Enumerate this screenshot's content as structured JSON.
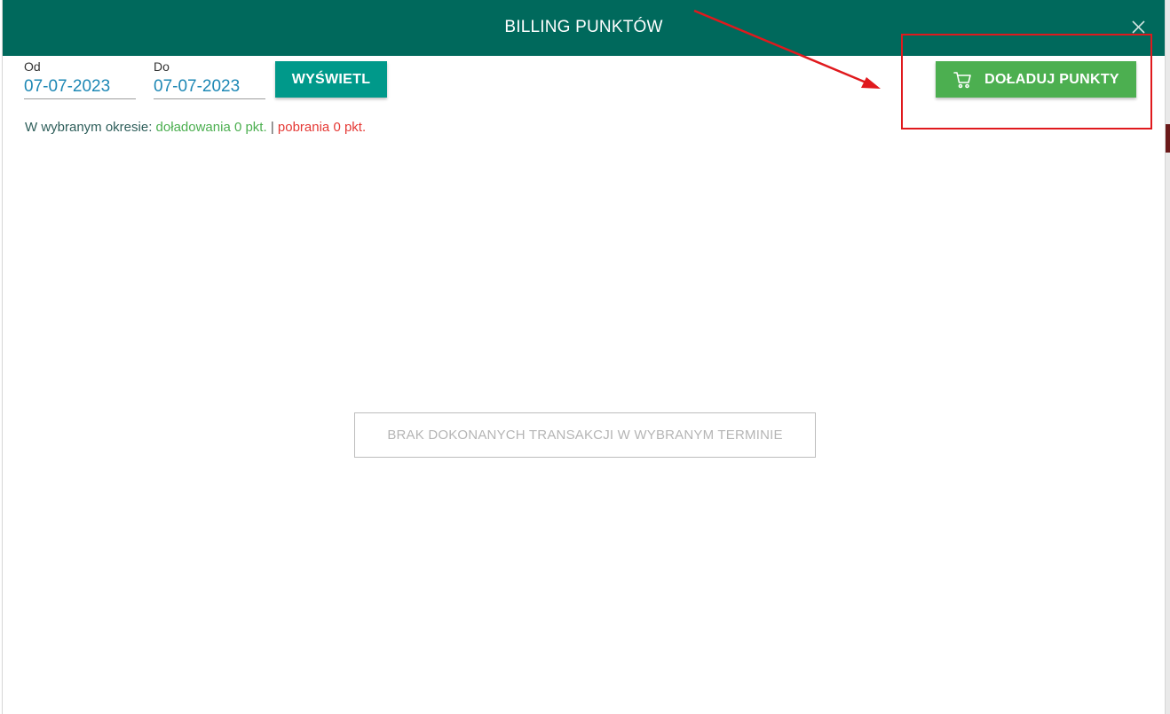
{
  "dialog": {
    "title": "BILLING PUNKTÓW"
  },
  "filters": {
    "from_label": "Od",
    "from_value": "07-07-2023",
    "to_label": "Do",
    "to_value": "07-07-2023",
    "show_button": "WYŚWIETL"
  },
  "actions": {
    "topup_button": "DOŁADUJ PUNKTY"
  },
  "summary": {
    "prefix": "W wybranym okresie:",
    "topups": "doładowania 0 pkt.",
    "separator": "|",
    "withdrawals": "pobrania 0 pkt."
  },
  "empty_state": {
    "message": "BRAK DOKONANYCH TRANSAKCJI W WYBRANYM TERMINIE"
  },
  "icons": {
    "close": "close-icon",
    "cart": "cart-icon"
  },
  "colors": {
    "header": "#00695c",
    "show_button": "#00998a",
    "topup_button": "#4caf50",
    "date_value": "#1e88b5",
    "topups_text": "#4caf50",
    "withdrawals_text": "#e53935",
    "annotation": "#e0191d"
  }
}
